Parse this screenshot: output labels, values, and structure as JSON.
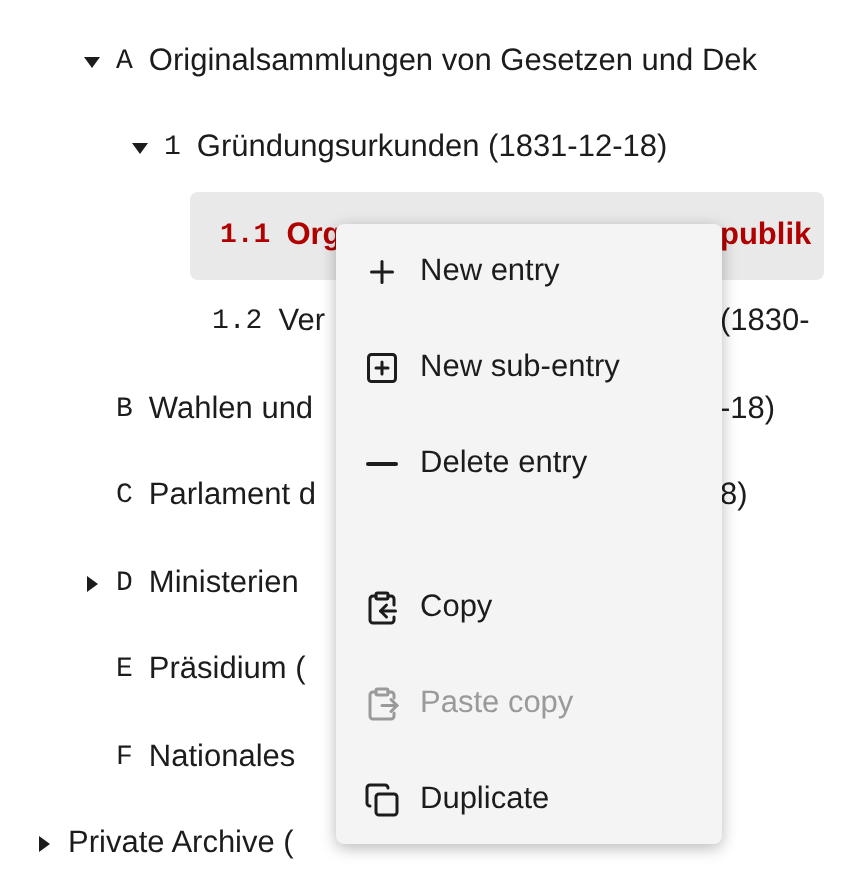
{
  "tree": [
    {
      "kind": "folder",
      "expanded": true,
      "selected": false,
      "number": "A",
      "parts": [
        "Originalsammlungen von Gesetzen und Dek"
      ],
      "children": [
        {
          "kind": "folder",
          "expanded": true,
          "selected": false,
          "number": "1",
          "parts": [
            "Gründungsurkunden (1831-12-18)"
          ],
          "children": [
            {
              "kind": "leaf",
              "selected": true,
              "number": "1.1",
              "parts": [
                "Org",
                "publik"
              ]
            },
            {
              "kind": "leaf",
              "selected": false,
              "number": "1.2",
              "parts": [
                "Ver",
                "(1830-"
              ]
            }
          ]
        }
      ]
    },
    {
      "kind": "leaf",
      "selected": false,
      "number": "B",
      "parts": [
        "Wahlen und",
        "-18)"
      ]
    },
    {
      "kind": "leaf",
      "selected": false,
      "number": "C",
      "parts": [
        "Parlament d",
        "8)"
      ]
    },
    {
      "kind": "folder",
      "expanded": false,
      "selected": false,
      "number": "D",
      "parts": [
        "Ministerien"
      ]
    },
    {
      "kind": "leaf",
      "selected": false,
      "number": "E",
      "parts": [
        "Präsidium ("
      ]
    },
    {
      "kind": "leaf",
      "selected": false,
      "number": "F",
      "parts": [
        "Nationales"
      ]
    }
  ],
  "root": {
    "kind": "folder",
    "expanded": false,
    "selected": false,
    "parts": [
      "Private Archive ("
    ]
  },
  "menu": {
    "groups": [
      [
        {
          "label": "New entry",
          "disabled": false
        },
        {
          "label": "New sub-entry",
          "disabled": false
        },
        {
          "label": "Delete entry",
          "disabled": false
        }
      ],
      [
        {
          "label": "Copy",
          "disabled": false
        },
        {
          "label": "Paste copy",
          "disabled": true
        },
        {
          "label": "Duplicate",
          "disabled": false
        }
      ]
    ]
  }
}
